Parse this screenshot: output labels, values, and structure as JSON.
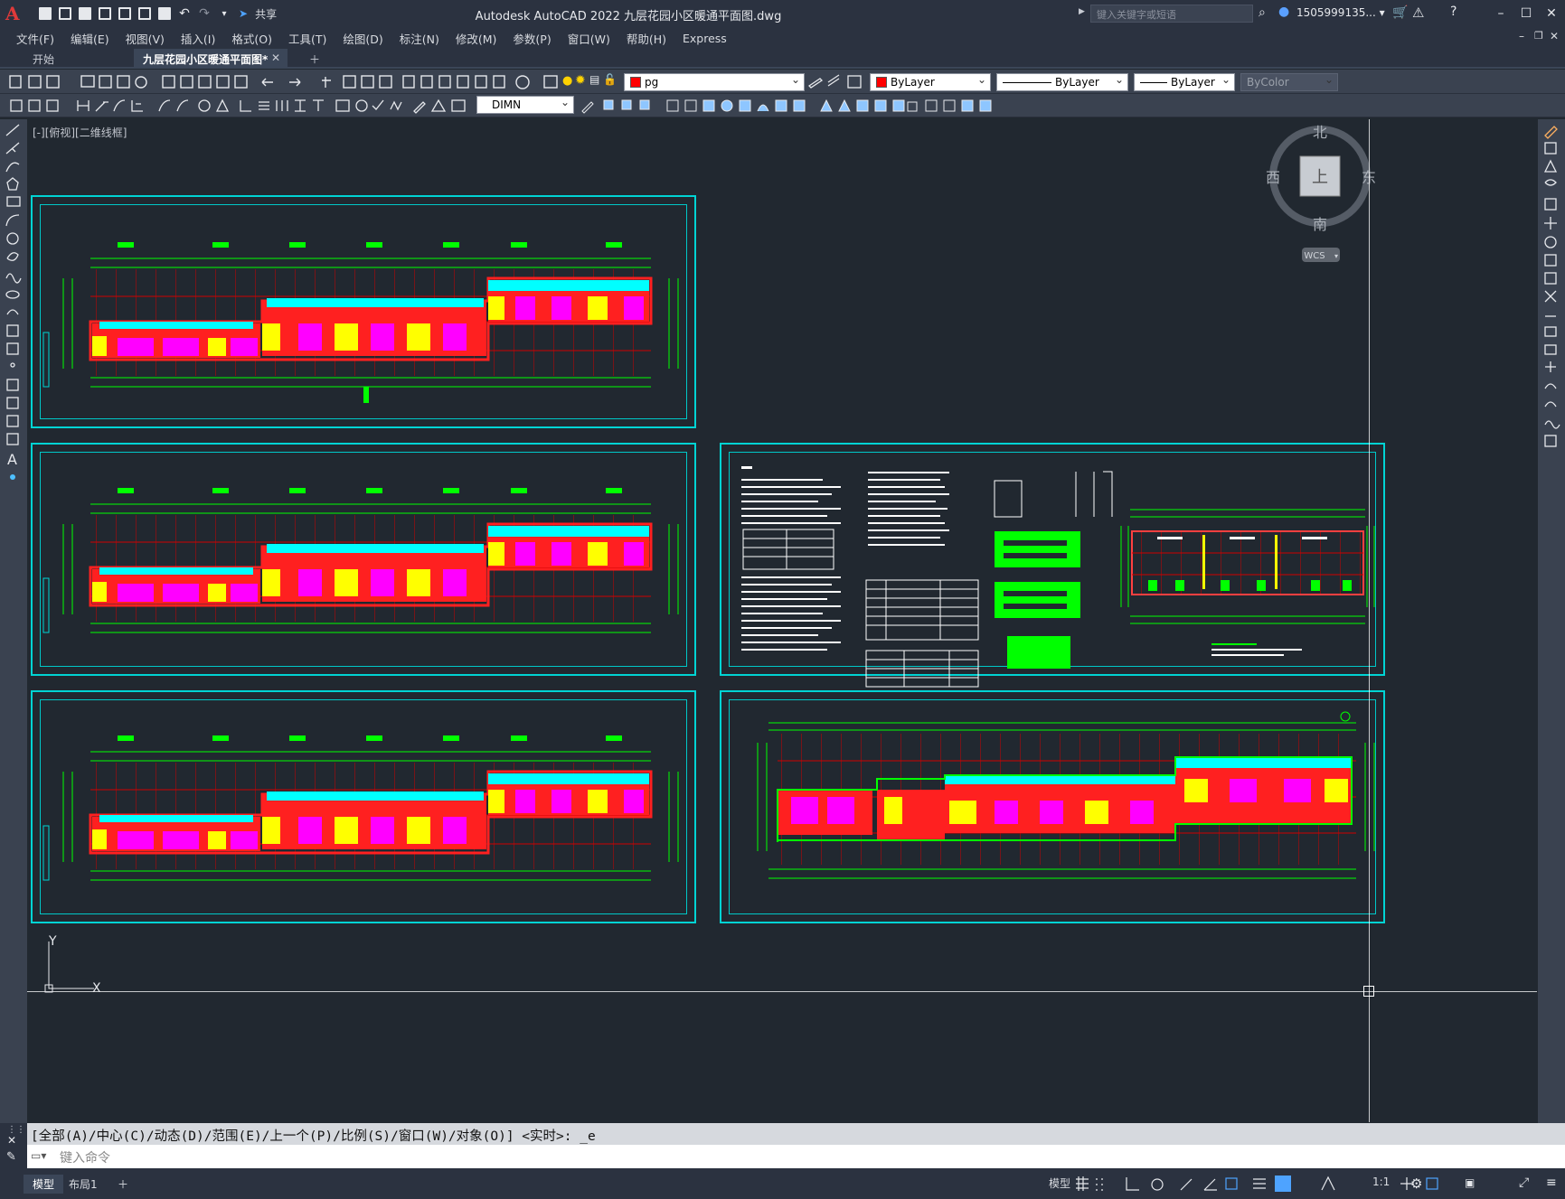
{
  "app": {
    "title": "Autodesk AutoCAD 2022    九层花园小区暖通平面图.dwg",
    "logo_letter": "A",
    "search_placeholder": "键入关键字或短语",
    "user": "1505999135... ▾",
    "share_label": "共享"
  },
  "menu": [
    "文件(F)",
    "编辑(E)",
    "视图(V)",
    "插入(I)",
    "格式(O)",
    "工具(T)",
    "绘图(D)",
    "标注(N)",
    "修改(M)",
    "参数(P)",
    "窗口(W)",
    "帮助(H)",
    "Express"
  ],
  "tabs": [
    {
      "label": "开始"
    },
    {
      "label": "九层花园小区暖通平面图*"
    }
  ],
  "properties": {
    "layer": "pg",
    "color": "ByLayer",
    "linetype": "ByLayer",
    "lineweight": "ByLayer",
    "plotstyle": "ByColor",
    "dimstyle": "DIMN"
  },
  "viewport": {
    "label": "[-][俯视][二维线框]",
    "compass": {
      "north": "北",
      "south": "南",
      "east": "东",
      "west": "西",
      "top": "上",
      "ucs": "WCS"
    },
    "ucs_x": "X",
    "ucs_y": "Y"
  },
  "command": {
    "history": "[全部(A)/中心(C)/动态(D)/范围(E)/上一个(P)/比例(S)/窗口(W)/对象(O)] <实时>: _e",
    "placeholder": "键入命令"
  },
  "layouts": [
    "模型",
    "布局1"
  ],
  "status": {
    "model": "模型",
    "scale": "1:1"
  },
  "colors": {
    "accent": "#00d4d4",
    "wall": "#ff0000",
    "grid": "#00ff00",
    "fill_yellow": "#ffff00",
    "fill_magenta": "#ff00ff",
    "fill_cyan": "#00ffff"
  }
}
